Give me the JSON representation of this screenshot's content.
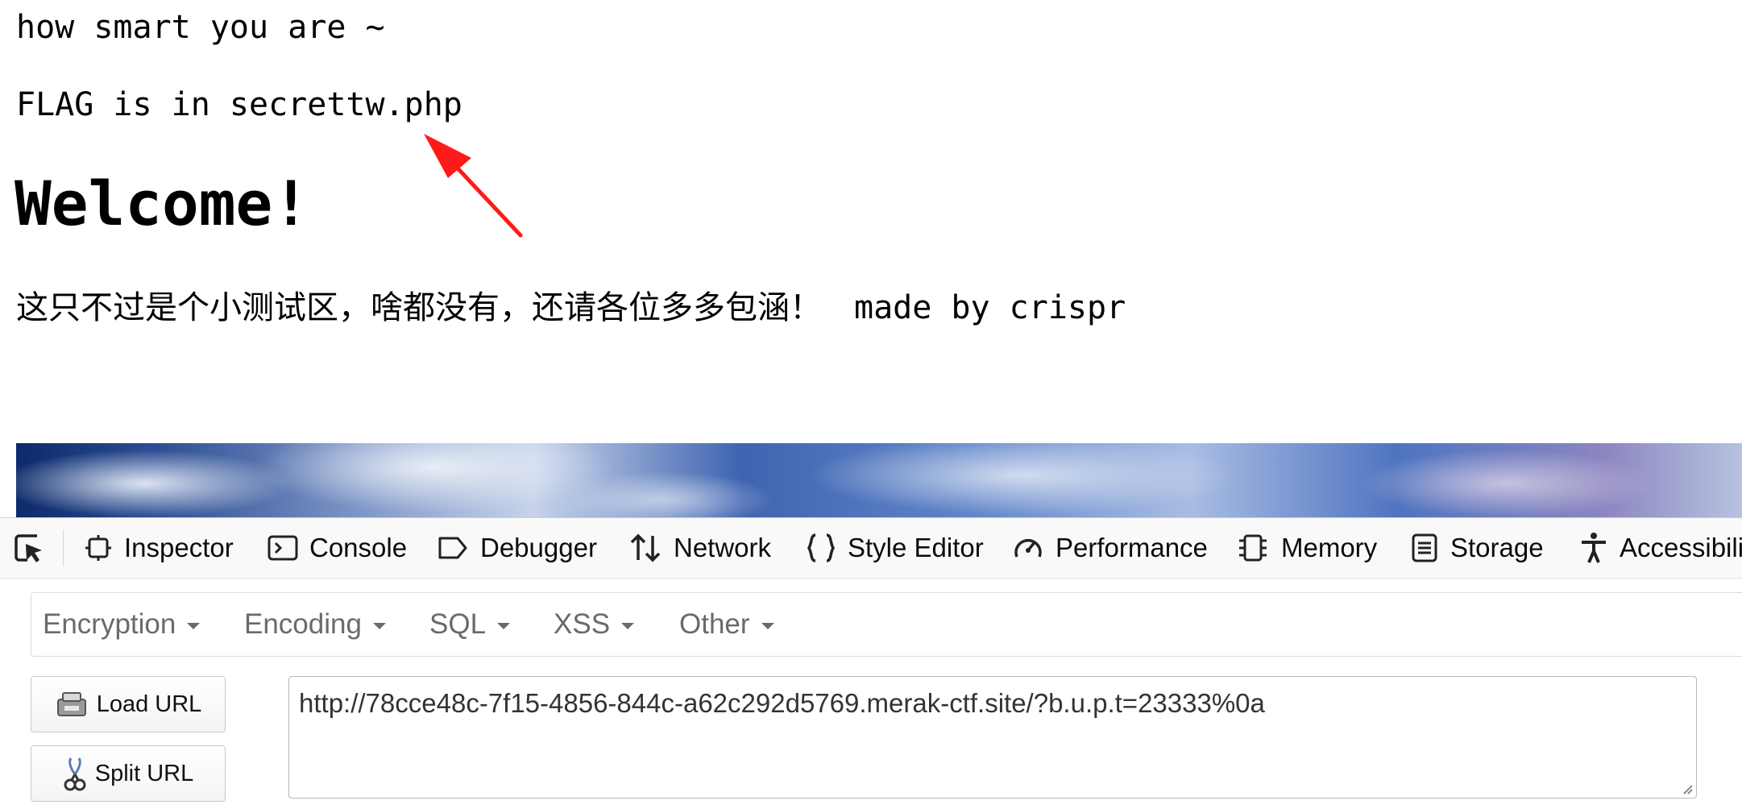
{
  "page": {
    "line1": "how smart you are ~",
    "line2": "FLAG is in secrettw.php",
    "heading": "Welcome!",
    "paragraph_cn": "这只不过是个小测试区，啥都没有，还请各位多多包涵！",
    "paragraph_en": "made by crispr"
  },
  "devtools": {
    "tabs": [
      {
        "label": "Inspector",
        "icon": "inspector-icon"
      },
      {
        "label": "Console",
        "icon": "console-icon"
      },
      {
        "label": "Debugger",
        "icon": "debugger-icon"
      },
      {
        "label": "Network",
        "icon": "network-icon"
      },
      {
        "label": "Style Editor",
        "icon": "style-editor-icon"
      },
      {
        "label": "Performance",
        "icon": "performance-icon"
      },
      {
        "label": "Memory",
        "icon": "memory-icon"
      },
      {
        "label": "Storage",
        "icon": "storage-icon"
      },
      {
        "label": "Accessibili",
        "icon": "accessibility-icon"
      }
    ]
  },
  "hackbar": {
    "menu": [
      "Encryption",
      "Encoding",
      "SQL",
      "XSS",
      "Other"
    ],
    "load_url_label": "Load URL",
    "split_url_label": "Split URL",
    "url_value": "http://78cce48c-7f15-4856-844c-a62c292d5769.merak-ctf.site/?b.u.p.t=23333%0a"
  },
  "colors": {
    "annotation_arrow": "#ff1a1a",
    "menu_text": "#6a6a6a"
  }
}
